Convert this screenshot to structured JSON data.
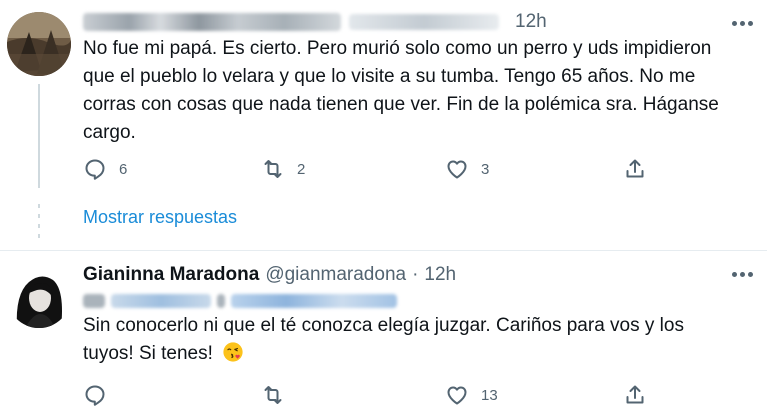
{
  "tweets": [
    {
      "time": "12h",
      "text": "No fue mi papá. Es cierto. Pero murió solo como un perro y uds impidieron que el pueblo lo velara y que lo visite a su tumba. Tengo 65 años. No me corras con cosas que nada tienen que ver. Fin de la polémica sra. Háganse cargo.",
      "actions": {
        "replies": "6",
        "retweets": "2",
        "likes": "3"
      },
      "show_replies": "Mostrar respuestas"
    },
    {
      "name": "Gianinna Maradona",
      "handle": "@gianmaradona",
      "separator": "·",
      "time": "12h",
      "text": "Sin conocerlo ni que el té conozca elegía juzgar. Cariños para vos y los tuyos! Si tenes!",
      "emoji": "face-blowing-kiss",
      "actions": {
        "replies": "",
        "retweets": "",
        "likes": "13"
      }
    }
  ],
  "icons": {
    "reply": "reply-icon",
    "retweet": "retweet-icon",
    "like": "like-icon",
    "share": "share-icon",
    "more": "more-icon"
  },
  "colors": {
    "link": "#1a8cd8",
    "secondary_text": "#536471",
    "divider": "#e6ecf0"
  }
}
